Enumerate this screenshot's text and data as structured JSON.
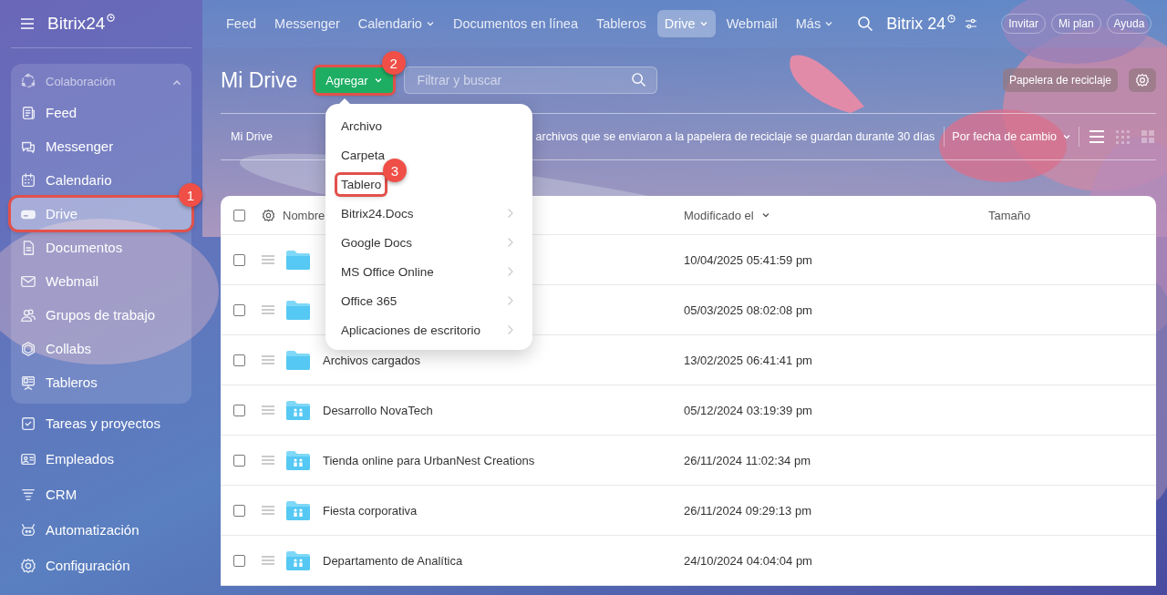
{
  "sidebar": {
    "logo": "Bitrix24",
    "group": {
      "label": "Colaboración",
      "expanded": true,
      "items": [
        {
          "label": "Feed",
          "kind": "feed",
          "selected": false
        },
        {
          "label": "Messenger",
          "kind": "chat",
          "selected": false
        },
        {
          "label": "Calendario",
          "kind": "calendar",
          "selected": false
        },
        {
          "label": "Drive",
          "kind": "drive",
          "selected": true,
          "callout": "1"
        },
        {
          "label": "Documentos",
          "kind": "doc",
          "selected": false
        },
        {
          "label": "Webmail",
          "kind": "mail",
          "selected": false
        },
        {
          "label": "Grupos de trabajo",
          "kind": "people",
          "selected": false
        },
        {
          "label": "Collabs",
          "kind": "hexagon",
          "selected": false
        },
        {
          "label": "Tableros",
          "kind": "board",
          "selected": false
        }
      ]
    },
    "items": [
      {
        "label": "Tareas y proyectos",
        "kind": "task",
        "selected": false
      },
      {
        "label": "Empleados",
        "kind": "card",
        "selected": false
      },
      {
        "label": "CRM",
        "kind": "funnel",
        "selected": false
      },
      {
        "label": "Automatización",
        "kind": "robot",
        "selected": false
      },
      {
        "label": "Configuración",
        "kind": "gear",
        "selected": false
      }
    ]
  },
  "topbar": {
    "nav": [
      {
        "label": "Feed",
        "selected": false,
        "has_menu": false
      },
      {
        "label": "Messenger",
        "selected": false,
        "has_menu": false
      },
      {
        "label": "Calendario",
        "selected": false,
        "has_menu": true
      },
      {
        "label": "Documentos en línea",
        "selected": false,
        "has_menu": false
      },
      {
        "label": "Tableros",
        "selected": false,
        "has_menu": false
      },
      {
        "label": "Drive",
        "selected": true,
        "has_menu": true
      },
      {
        "label": "Webmail",
        "selected": false,
        "has_menu": false
      },
      {
        "label": "Más",
        "selected": false,
        "has_menu": true
      }
    ],
    "logo": "Bitrix 24",
    "buttons": [
      "Invitar",
      "Mi plan",
      "Ayuda"
    ]
  },
  "page": {
    "title": "Mi Drive",
    "add_button": {
      "label": "Agregar",
      "callout": "2"
    },
    "search": {
      "placeholder": "Filtrar y buscar"
    },
    "trash_button": "Papelera de reciclaje",
    "breadcrumb": "Mi Drive",
    "notice": "archivos que se enviaron a la papelera de reciclaje se guardan durante 30 días",
    "sort": "Por fecha de cambio",
    "views": [
      {
        "kind": "list",
        "selected": true
      },
      {
        "kind": "tiles",
        "selected": false
      },
      {
        "kind": "big",
        "selected": false
      }
    ]
  },
  "add_menu": {
    "items": [
      {
        "label": "Archivo",
        "has_submenu": false
      },
      {
        "label": "Carpeta",
        "has_submenu": false
      },
      {
        "label": "Tablero",
        "has_submenu": false,
        "callout": "3"
      },
      {
        "label": "Bitrix24.Docs",
        "has_submenu": true
      },
      {
        "label": "Google Docs",
        "has_submenu": true
      },
      {
        "label": "MS Office Online",
        "has_submenu": true
      },
      {
        "label": "Office 365",
        "has_submenu": true
      },
      {
        "label": "Aplicaciones de escritorio",
        "has_submenu": true
      }
    ]
  },
  "table": {
    "all_checked": false,
    "columns": [
      "Nombre",
      "Modificado el",
      "Tamaño"
    ],
    "rows": [
      {
        "kind": "folder",
        "modified": "10/04/2025 05:41:59 pm",
        "checked": false
      },
      {
        "kind": "folder",
        "modified": "05/03/2025 08:02:08 pm",
        "checked": false
      },
      {
        "name": "Archivos cargados",
        "kind": "folder",
        "modified": "13/02/2025 06:41:41 pm",
        "checked": false
      },
      {
        "name": "Desarrollo NovaTech",
        "kind": "shared",
        "modified": "05/12/2024 03:19:39 pm",
        "checked": false
      },
      {
        "name": "Tienda online para UrbanNest Creations",
        "kind": "shared",
        "modified": "26/11/2024 11:02:34 pm",
        "checked": false
      },
      {
        "name": "Fiesta corporativa",
        "kind": "shared",
        "modified": "26/11/2024 09:29:13 pm",
        "checked": false
      },
      {
        "name": "Departamento de Analítica",
        "kind": "shared",
        "modified": "24/10/2024 04:04:04 pm",
        "checked": false
      }
    ]
  }
}
